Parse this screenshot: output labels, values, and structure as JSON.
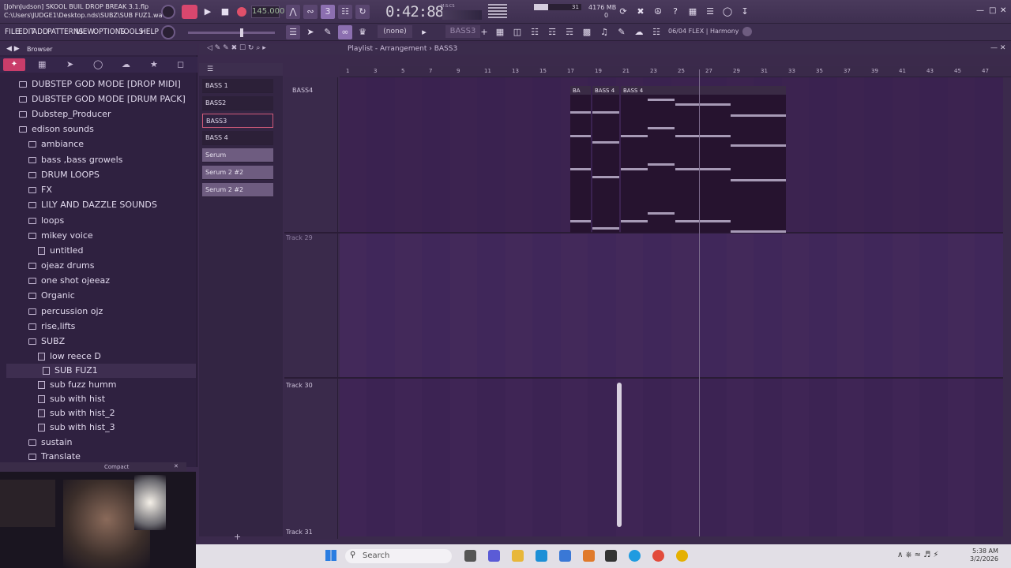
{
  "window": {
    "title_line1": "[JohnJudson] SKOOL BUIL DROP BREAK 3.1.flp",
    "title_line2": "C:\\Users\\JUDGE1\\Desktop.nds\\SUBZ\\SUB FUZ1.wav"
  },
  "transport": {
    "tempo": "145.000",
    "time": "0:42:88",
    "time_unit": "M:S:CS",
    "cpu_value": "31",
    "memory": "4176 MB",
    "memory_sub": "0"
  },
  "menu": [
    "FILE",
    "EDIT",
    "ADD",
    "PATTERNS",
    "VIEW",
    "OPTIONS",
    "TOOLS",
    "HELP"
  ],
  "toolbar2": {
    "snap": "(none)",
    "pattern": "BASS3",
    "hint": "06/04  FLEX | Harmony"
  },
  "browser": {
    "title": "Browser",
    "items": [
      {
        "label": "DUBSTEP GOD MODE [DROP MIDI]",
        "indent": 1,
        "kind": "folder"
      },
      {
        "label": "DUBSTEP GOD MODE [DRUM PACK]",
        "indent": 1,
        "kind": "folder"
      },
      {
        "label": "Dubstep_Producer",
        "indent": 1,
        "kind": "folder"
      },
      {
        "label": "edison sounds",
        "indent": 1,
        "kind": "folder"
      },
      {
        "label": "ambiance",
        "indent": 2,
        "kind": "folder"
      },
      {
        "label": "bass ,bass growels",
        "indent": 2,
        "kind": "folder"
      },
      {
        "label": "DRUM LOOPS",
        "indent": 2,
        "kind": "folder"
      },
      {
        "label": "FX",
        "indent": 2,
        "kind": "folder"
      },
      {
        "label": "LILY AND DAZZLE SOUNDS",
        "indent": 2,
        "kind": "folder"
      },
      {
        "label": "loops",
        "indent": 2,
        "kind": "folder"
      },
      {
        "label": "mikey voice",
        "indent": 2,
        "kind": "folder"
      },
      {
        "label": "untitled",
        "indent": 3,
        "kind": "file"
      },
      {
        "label": "ojeaz drums",
        "indent": 2,
        "kind": "folder"
      },
      {
        "label": "one shot ojeeaz",
        "indent": 2,
        "kind": "folder"
      },
      {
        "label": "Organic",
        "indent": 2,
        "kind": "folder"
      },
      {
        "label": "percussion ojz",
        "indent": 2,
        "kind": "folder"
      },
      {
        "label": "rise,lifts",
        "indent": 2,
        "kind": "folder"
      },
      {
        "label": "SUBZ",
        "indent": 2,
        "kind": "folder"
      },
      {
        "label": "low reece D",
        "indent": 3,
        "kind": "file"
      },
      {
        "label": "SUB FUZ1",
        "indent": 3,
        "kind": "file"
      },
      {
        "label": "sub fuzz humm",
        "indent": 3,
        "kind": "file"
      },
      {
        "label": "sub with hist",
        "indent": 3,
        "kind": "file"
      },
      {
        "label": "sub with hist_2",
        "indent": 3,
        "kind": "file"
      },
      {
        "label": "sub with hist_3",
        "indent": 3,
        "kind": "file"
      },
      {
        "label": "sustain",
        "indent": 2,
        "kind": "folder"
      },
      {
        "label": "Translate",
        "indent": 2,
        "kind": "folder"
      }
    ]
  },
  "channels": [
    {
      "label": "BASS 1",
      "type": "pattern"
    },
    {
      "label": "BASS2",
      "type": "pattern"
    },
    {
      "label": "BASS3",
      "type": "selected"
    },
    {
      "label": "BASS 4",
      "type": "pattern"
    },
    {
      "label": "Serum",
      "type": "plugin"
    },
    {
      "label": "Serum 2 #2",
      "type": "plugin"
    },
    {
      "label": "Serum 2 #2",
      "type": "plugin"
    }
  ],
  "playlist": {
    "title": "Playlist - Arrangement",
    "pattern": "BASS3",
    "ruler": [
      "1",
      "3",
      "5",
      "7",
      "9",
      "11",
      "13",
      "15",
      "17",
      "19",
      "21",
      "23",
      "25",
      "27",
      "29",
      "31",
      "33",
      "35",
      "37",
      "39",
      "41",
      "43",
      "45",
      "47"
    ],
    "tracks": [
      "BASS4",
      "Track 29",
      "Track 30",
      "Track 31"
    ],
    "clips": [
      {
        "label": "BA"
      },
      {
        "label": "BASS 4"
      },
      {
        "label": "BASS 4"
      }
    ]
  },
  "webcam": {
    "title": "Compact"
  },
  "taskbar": {
    "search_placeholder": "Search",
    "time": "5:38 AM",
    "date": "3/2/2026"
  }
}
